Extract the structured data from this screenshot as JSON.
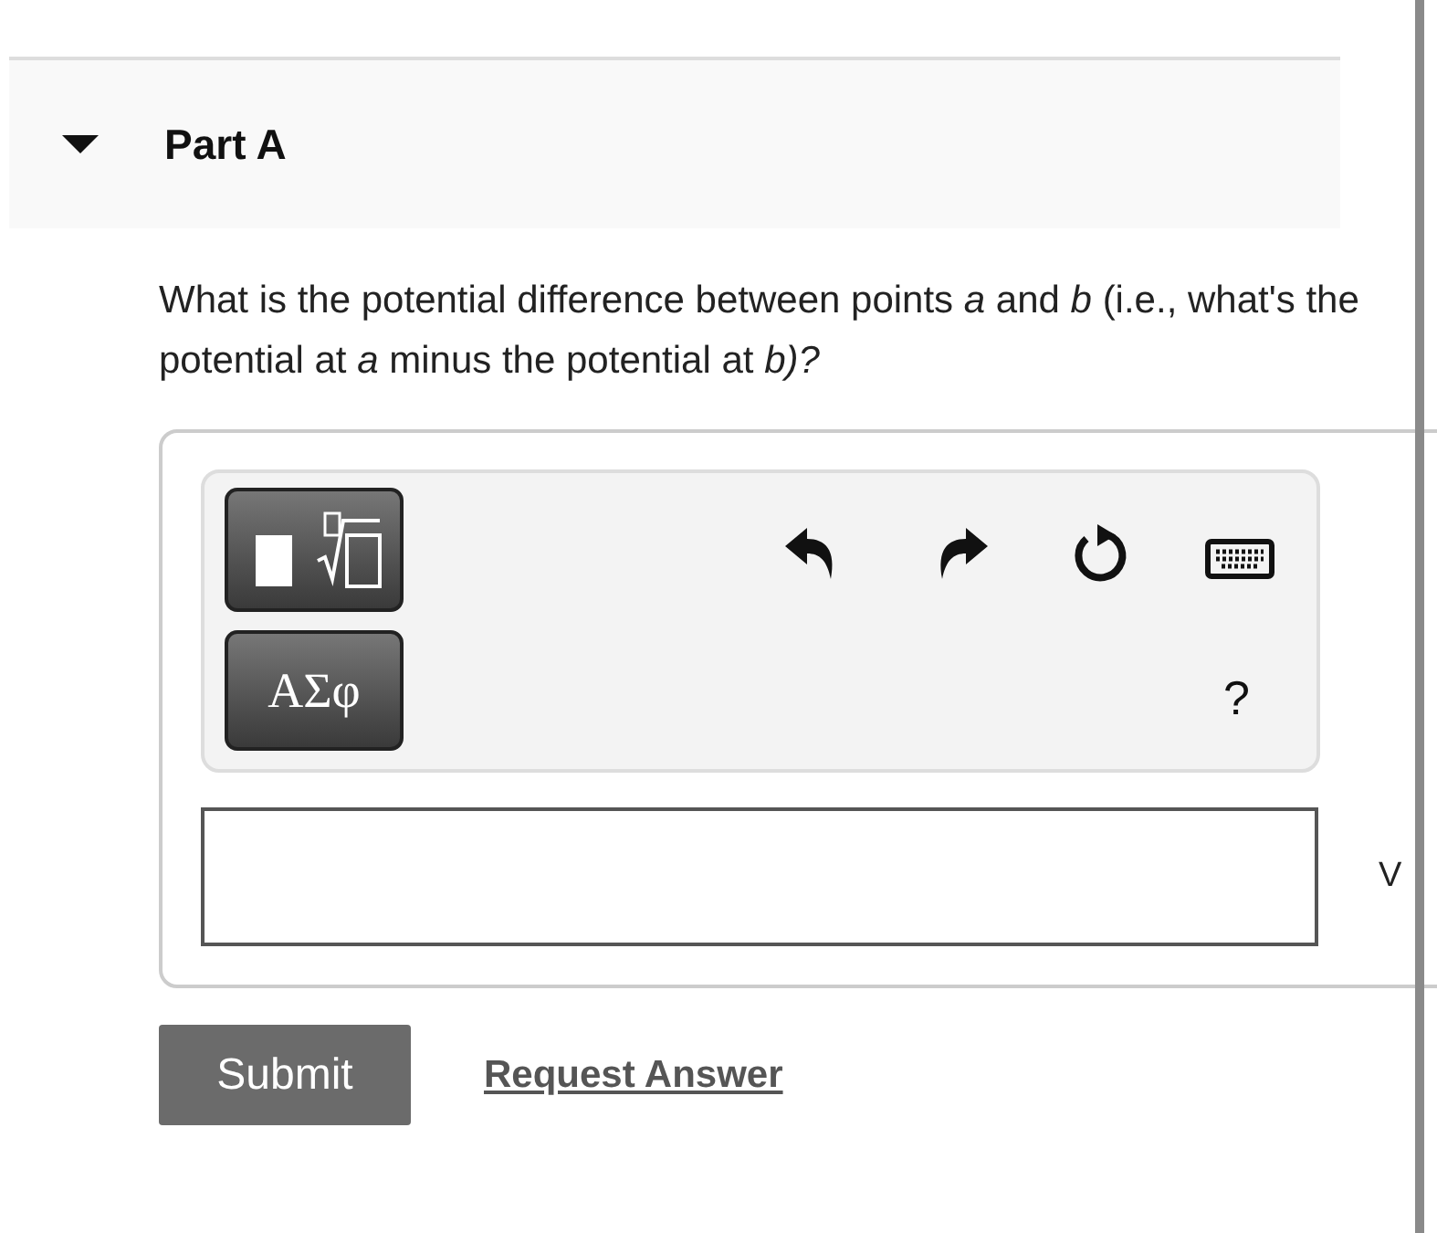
{
  "part": {
    "title": "Part A",
    "expanded": true
  },
  "question": "What is the potential difference between points *a* and *b* (i.e., what's the potential at *a* minus the potential at *b)?*",
  "toolbar": {
    "symbols_button": "ΑΣφ",
    "help": "?"
  },
  "answer": {
    "unit": "V"
  },
  "submit_button": "Submit",
  "request_answer_link": "Request Answer"
}
